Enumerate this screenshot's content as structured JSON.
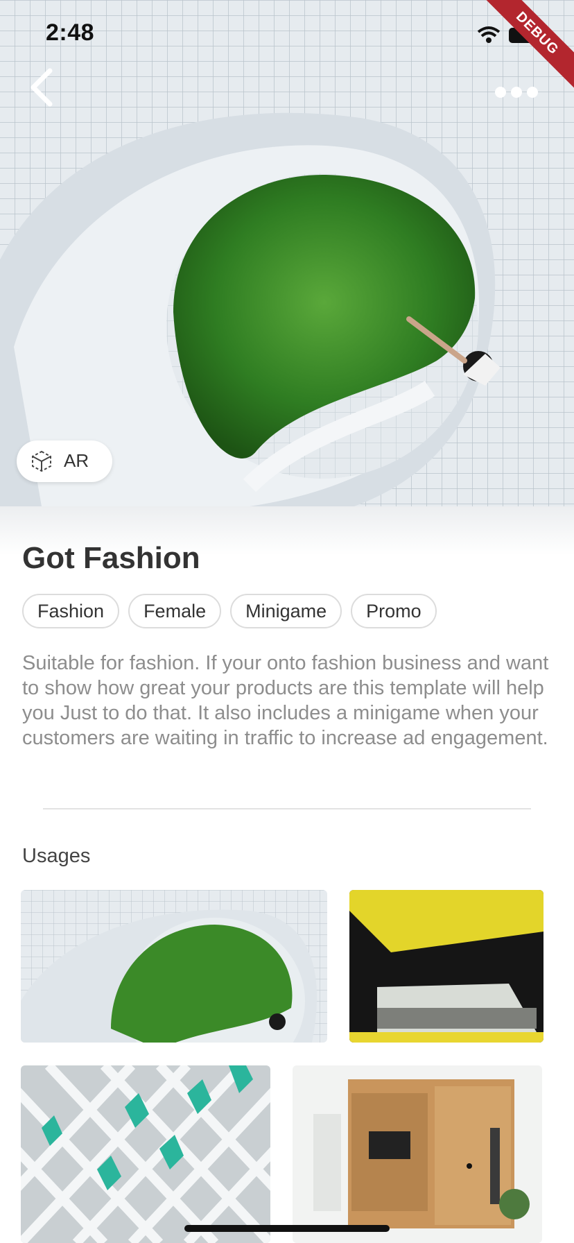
{
  "status_bar": {
    "time": "2:48"
  },
  "debug_banner": "DEBUG",
  "ar_button": {
    "label": "AR"
  },
  "title": "Got Fashion",
  "tags": [
    "Fashion",
    "Female",
    "Minigame",
    "Promo"
  ],
  "description": "Suitable for fashion. If your onto fashion business and want to show how great your products are this template will help you Just to do that. It also includes a minigame when your customers are waiting in traffic to increase ad engagement.",
  "usages_heading": "Usages",
  "icons": {
    "back": "chevron-left-icon",
    "more": "more-horizontal-icon",
    "ar": "cube-icon",
    "wifi": "wifi-icon",
    "battery": "battery-icon"
  },
  "colors": {
    "debug_banner": "#b3262e",
    "title": "#333333",
    "description": "#8d8d8d"
  }
}
